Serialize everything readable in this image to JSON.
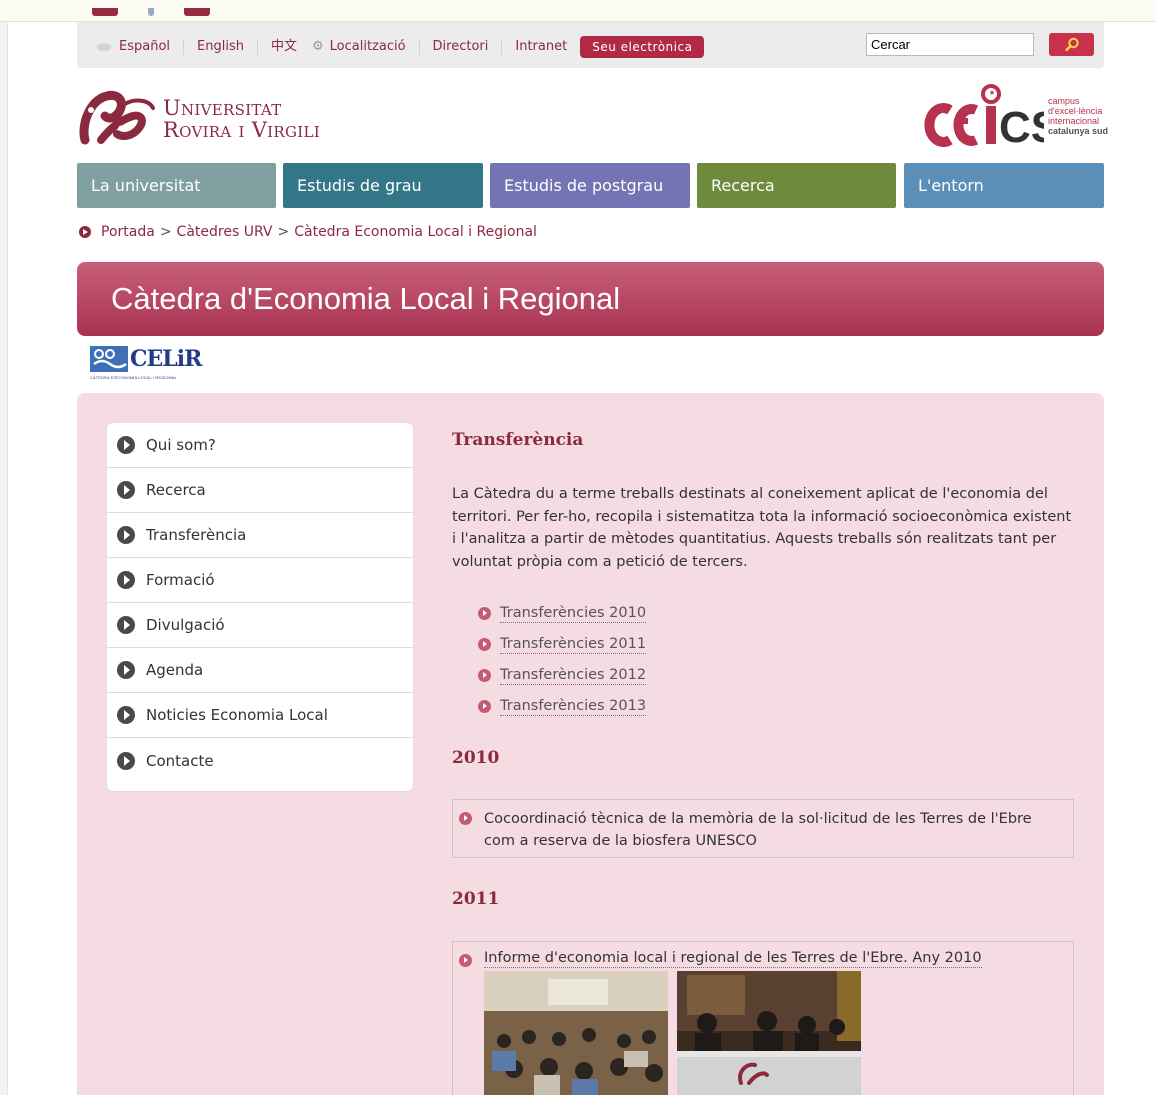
{
  "colors": {
    "brand": "#8b2a3f",
    "accent": "#b02a45",
    "content_bg": "#f4dce2"
  },
  "topbar": {
    "links": [
      "Español",
      "English",
      "中文",
      "Localització",
      "Directori",
      "Intranet"
    ],
    "seu_button": "Seu electrònica",
    "search_value": "Cercar"
  },
  "header": {
    "urv_line1": "Universitat",
    "urv_line2": "Rovira i Virgili",
    "ceics_logo": "CEICS",
    "ceics_lines": [
      "campus",
      "d'excel·lència",
      "internacional",
      "catalunya sud"
    ]
  },
  "nav": {
    "items": [
      "La universitat",
      "Estudis de grau",
      "Estudis de postgrau",
      "Recerca",
      "L'entorn"
    ],
    "colors": [
      "#7f9fa0",
      "#337688",
      "#7474b4",
      "#6e8a3c",
      "#5b8fb8"
    ]
  },
  "breadcrumb": [
    "Portada",
    "Càtedres URV",
    "Càtedra Economia Local i Regional"
  ],
  "page_title": "Càtedra d'Economia Local i Regional",
  "celir_logo": {
    "word": "CELiR",
    "subtitle": "CÀTEDRA D'ECONOMIA LOCAL I REGIONAL"
  },
  "sidebar": [
    "Qui som?",
    "Recerca",
    "Transferència",
    "Formació",
    "Divulgació",
    "Agenda",
    "Noticies Economia Local",
    "Contacte"
  ],
  "main": {
    "title": "Transferència",
    "intro": "La Càtedra du a terme treballs destinats al coneixement aplicat de l'economia del territori. Per fer-ho, recopila i sistematitza tota la informació socioeconòmica existent i l'analitza a partir de mètodes quantitatius. Aquests treballs són realitzats tant per voluntat pròpia com a petició de tercers.",
    "links": [
      "Transferències 2010",
      "Transferències 2011",
      "Transferències 2012",
      "Transferències 2013"
    ],
    "year1": "2010",
    "item1": "Cocoordinació tècnica de la memòria de la sol·licitud de les Terres de l'Ebre com a reserva de la biosfera UNESCO",
    "year2": "2011",
    "item2": "Informe d'economia local i regional de les Terres de l'Ebre. Any 2010"
  }
}
